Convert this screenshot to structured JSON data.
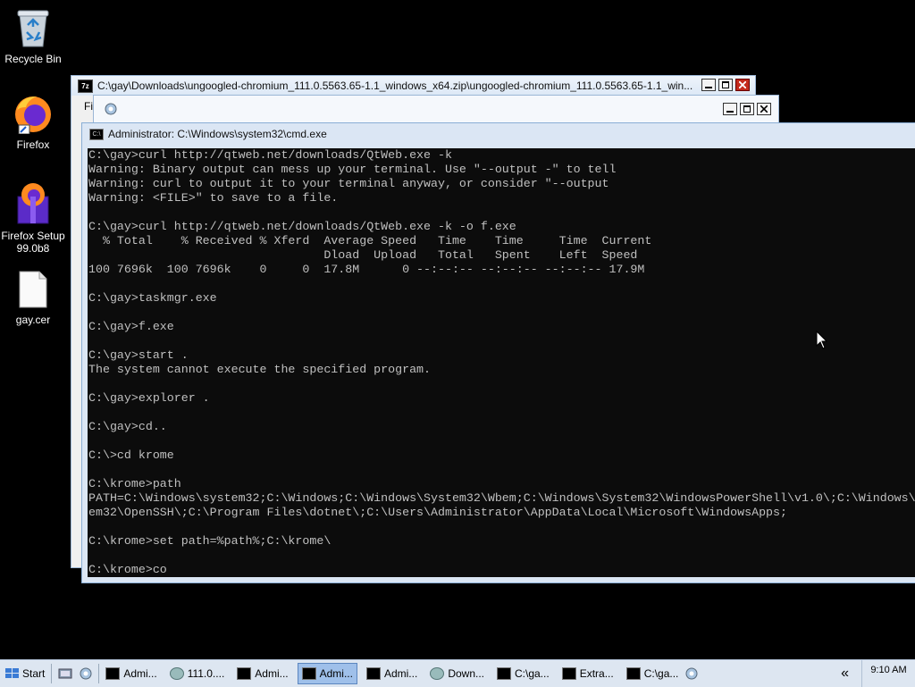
{
  "desktop": {
    "icons": [
      {
        "label": "Recycle Bin"
      },
      {
        "label": "Firefox"
      },
      {
        "label": "Firefox Setup 99.0b8"
      },
      {
        "label": "gay.cer"
      }
    ]
  },
  "zip_window": {
    "title": "C:\\gay\\Downloads\\ungoogled-chromium_111.0.5563.65-1.1_windows_x64.zip\\ungoogled-chromium_111.0.5563.65-1.1_win...",
    "menu_fragment": "Fi",
    "icon_label": "7z"
  },
  "blank_window": {
    "title": ""
  },
  "cmd_window": {
    "title": "Administrator: C:\\Windows\\system32\\cmd.exe",
    "icon_label": "C:\\",
    "lines": [
      "C:\\gay>curl http://qtweb.net/downloads/QtWeb.exe -k",
      "Warning: Binary output can mess up your terminal. Use \"--output -\" to tell",
      "Warning: curl to output it to your terminal anyway, or consider \"--output",
      "Warning: <FILE>\" to save to a file.",
      "",
      "C:\\gay>curl http://qtweb.net/downloads/QtWeb.exe -k -o f.exe",
      "  % Total    % Received % Xferd  Average Speed   Time    Time     Time  Current",
      "                                 Dload  Upload   Total   Spent    Left  Speed",
      "100 7696k  100 7696k    0     0  17.8M      0 --:--:-- --:--:-- --:--:-- 17.9M",
      "",
      "C:\\gay>taskmgr.exe",
      "",
      "C:\\gay>f.exe",
      "",
      "C:\\gay>start .",
      "The system cannot execute the specified program.",
      "",
      "C:\\gay>explorer .",
      "",
      "C:\\gay>cd..",
      "",
      "C:\\>cd krome",
      "",
      "C:\\krome>path",
      "PATH=C:\\Windows\\system32;C:\\Windows;C:\\Windows\\System32\\Wbem;C:\\Windows\\System32\\WindowsPowerShell\\v1.0\\;C:\\Windows\\",
      "em32\\OpenSSH\\;C:\\Program Files\\dotnet\\;C:\\Users\\Administrator\\AppData\\Local\\Microsoft\\WindowsApps;",
      "",
      "C:\\krome>set path=%path%;C:\\krome\\",
      "",
      "C:\\krome>co"
    ]
  },
  "taskbar": {
    "start_label": "Start",
    "items": [
      {
        "label": "Admi...",
        "icon": "cmd",
        "active": false
      },
      {
        "label": "111.0....",
        "icon": "chromium",
        "active": false
      },
      {
        "label": "Admi...",
        "icon": "cmd",
        "active": false
      },
      {
        "label": "Admi...",
        "icon": "cmd",
        "active": true
      },
      {
        "label": "Admi...",
        "icon": "cmd",
        "active": false
      },
      {
        "label": "Down...",
        "icon": "chromium",
        "active": false
      },
      {
        "label": "C:\\ga...",
        "icon": "zip",
        "active": false
      },
      {
        "label": "Extra...",
        "icon": "zip",
        "active": false
      },
      {
        "label": "C:\\ga...",
        "icon": "zip",
        "active": false
      }
    ],
    "tray_arrow": "«",
    "clock": "9:10 AM"
  }
}
